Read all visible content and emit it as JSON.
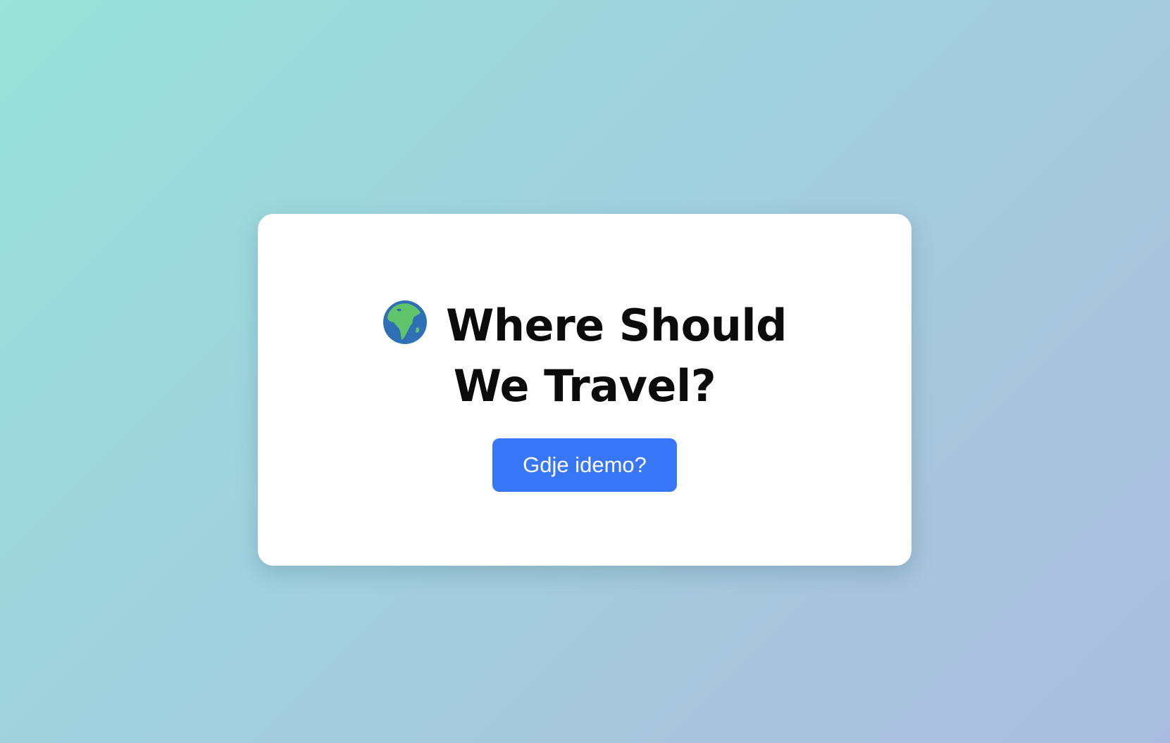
{
  "card": {
    "title_icon": "globe-europe-africa-icon",
    "title_text": "Where Should We Travel?"
  },
  "action_button": {
    "label": "Gdje idemo?",
    "color": "#3777f7"
  }
}
